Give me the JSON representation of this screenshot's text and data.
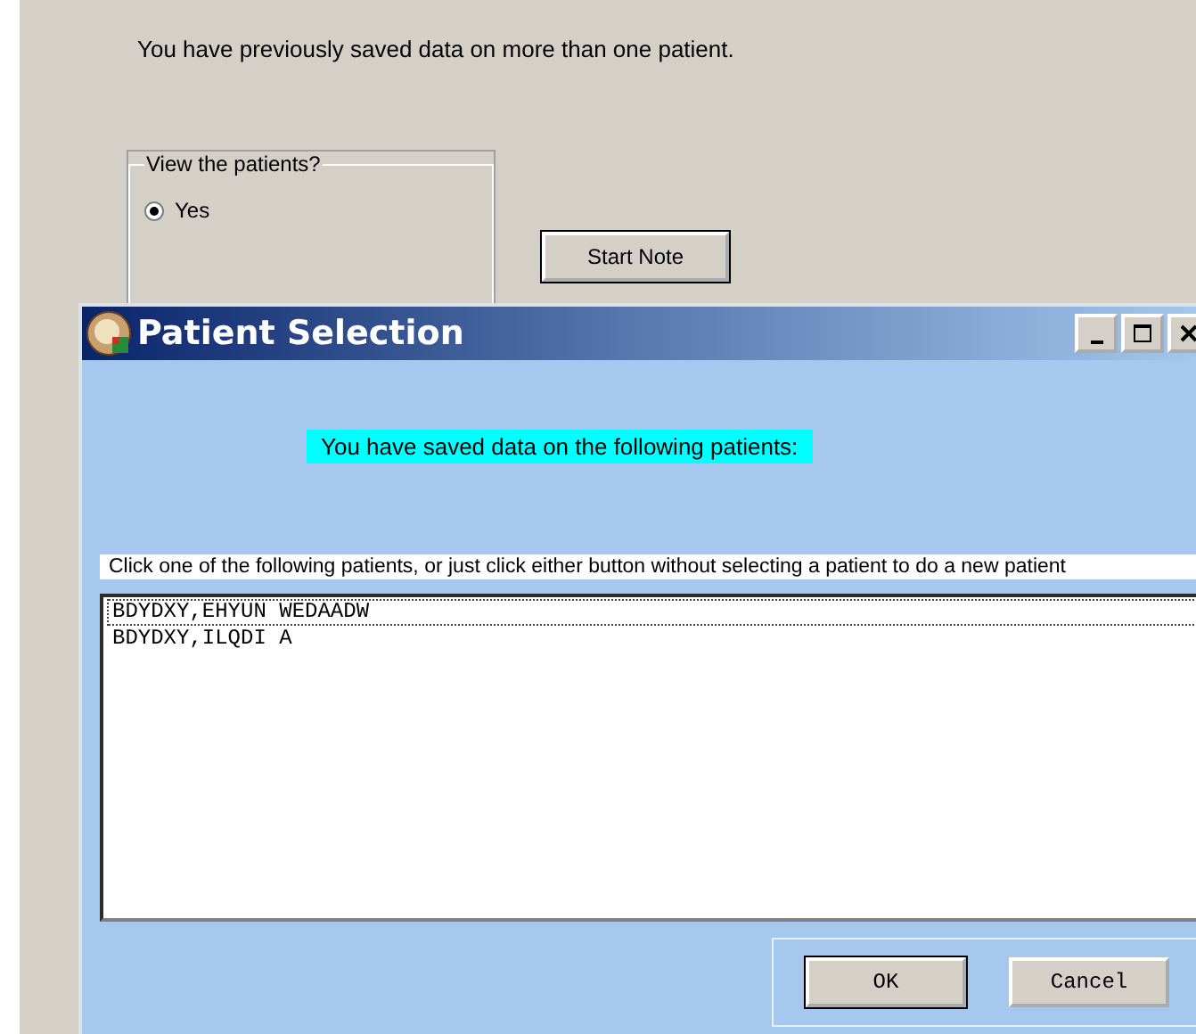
{
  "background_window": {
    "message": "You have previously saved data on more than one patient.",
    "group": {
      "title": "View the patients?",
      "options": [
        {
          "label": "Yes",
          "selected": true
        }
      ]
    },
    "button": "Start Note"
  },
  "dialog": {
    "title": "Patient Selection",
    "banner": "You have saved data on the following patients:",
    "instruction": "Click one of the following patients, or just click either button without selecting a patient to do a new patient",
    "patients": [
      {
        "name": "BDYDXY,EHYUN WEDAADW",
        "focused": true
      },
      {
        "name": "BDYDXY,ILQDI A",
        "focused": false
      }
    ],
    "buttons": [
      {
        "label": "OK",
        "default": true
      },
      {
        "label": "Cancel",
        "default": false
      }
    ]
  }
}
